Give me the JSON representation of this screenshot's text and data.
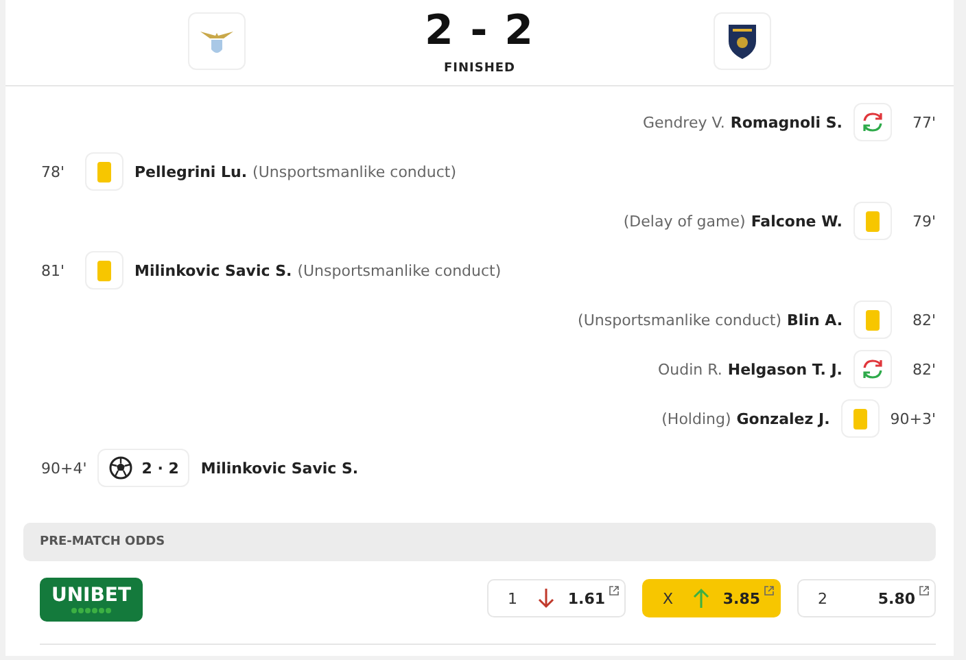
{
  "match": {
    "home_score": "2",
    "separator": "-",
    "away_score": "2",
    "status": "FINISHED"
  },
  "events": [
    {
      "away": true,
      "kind": "substitution",
      "minute": "77'",
      "player": "Romagnoli S.",
      "detail": "Gendrey V."
    },
    {
      "away": false,
      "kind": "yellow_card",
      "minute": "78'",
      "player": "Pellegrini Lu.",
      "detail": "(Unsportsmanlike conduct)"
    },
    {
      "away": true,
      "kind": "yellow_card",
      "minute": "79'",
      "player": "Falcone W.",
      "detail": "(Delay of game)"
    },
    {
      "away": false,
      "kind": "yellow_card",
      "minute": "81'",
      "player": "Milinkovic Savic S.",
      "detail": "(Unsportsmanlike conduct)"
    },
    {
      "away": true,
      "kind": "yellow_card",
      "minute": "82'",
      "player": "Blin A.",
      "detail": "(Unsportsmanlike conduct)"
    },
    {
      "away": true,
      "kind": "substitution",
      "minute": "82'",
      "player": "Helgason T. J.",
      "detail": "Oudin R."
    },
    {
      "away": true,
      "kind": "yellow_card",
      "minute": "90+3'",
      "player": "Gonzalez J.",
      "detail": "(Holding)"
    },
    {
      "away": false,
      "kind": "goal",
      "minute": "90+4'",
      "player": "Milinkovic Savic S.",
      "score": "2 · 2"
    }
  ],
  "odds": {
    "title": "PRE-MATCH ODDS",
    "bookmaker": "UNIBET",
    "items": [
      {
        "label": "1",
        "value": "1.61",
        "rising": false,
        "falling": true,
        "selected": false
      },
      {
        "label": "X",
        "value": "3.85",
        "rising": true,
        "falling": false,
        "selected": true
      },
      {
        "label": "2",
        "value": "5.80",
        "rising": false,
        "falling": false,
        "selected": false
      }
    ]
  }
}
